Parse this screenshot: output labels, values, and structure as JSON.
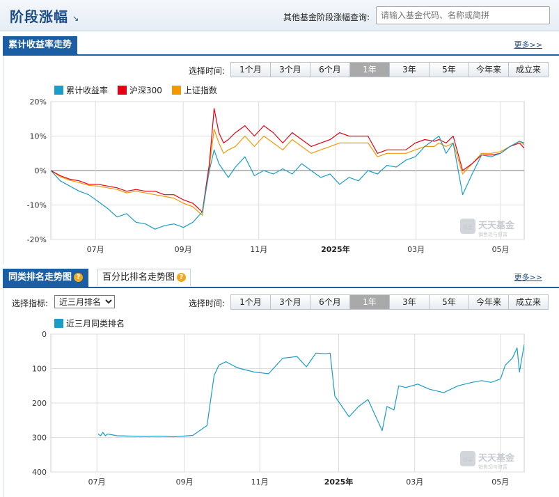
{
  "header": {
    "title": "阶段涨幅",
    "title_arrow": "↘",
    "search_label": "其他基金阶段涨幅查询:",
    "search_placeholder": "请输入基金代码、名称或简拼"
  },
  "section1": {
    "tab": "累计收益率走势",
    "more": "更多>>",
    "time_label": "选择时间:",
    "ranges": [
      "1个月",
      "3个月",
      "6个月",
      "1年",
      "3年",
      "5年",
      "今年来",
      "成立来"
    ],
    "active_range": "1年"
  },
  "section2": {
    "tab_active": "同类排名走势图",
    "tab_inactive": "百分比排名走势图",
    "more": "更多>>",
    "indicator_label": "选择指标:",
    "indicator_value": "近三月排名",
    "time_label": "选择时间:",
    "ranges": [
      "1个月",
      "3个月",
      "6个月",
      "1年",
      "3年",
      "5年",
      "今年来",
      "成立来"
    ],
    "active_range": "1年"
  },
  "watermark": {
    "logo": "天天基金",
    "slogan": "销售您与财富",
    "badge": "基金"
  },
  "colors": {
    "fund": "#1a9dc6",
    "hs300": "#e60012",
    "sh_index": "#f39800",
    "accent": "#1b5ea3"
  },
  "chart_data": [
    {
      "type": "line",
      "title": "",
      "xlabel": "",
      "ylabel": "",
      "ylim": [
        -20,
        20
      ],
      "y_ticks": [
        "20%",
        "10%",
        "0%",
        "-10%",
        "-20%"
      ],
      "x_ticks": [
        "07月",
        "09月",
        "11月",
        "2025年",
        "03月",
        "05月"
      ],
      "x_tick_pos": [
        0.0943,
        0.2796,
        0.4393,
        0.6013,
        0.7715,
        0.9501
      ],
      "grid": true,
      "legend": "top-left",
      "x": [
        0,
        0.02,
        0.04,
        0.06,
        0.08,
        0.1,
        0.12,
        0.14,
        0.16,
        0.18,
        0.2,
        0.22,
        0.24,
        0.26,
        0.28,
        0.3,
        0.32,
        0.335,
        0.345,
        0.355,
        0.365,
        0.375,
        0.39,
        0.41,
        0.43,
        0.45,
        0.47,
        0.49,
        0.51,
        0.53,
        0.55,
        0.57,
        0.59,
        0.61,
        0.63,
        0.65,
        0.67,
        0.69,
        0.71,
        0.73,
        0.75,
        0.77,
        0.79,
        0.81,
        0.82,
        0.835,
        0.85,
        0.87,
        0.89,
        0.91,
        0.93,
        0.95,
        0.97,
        0.99,
        1.0
      ],
      "series": [
        {
          "name": "累计收益率",
          "color": "#1a9dc6",
          "values": [
            0,
            -3,
            -4.5,
            -6,
            -7,
            -9,
            -11,
            -13.5,
            -12.5,
            -15,
            -15.5,
            -17,
            -16,
            -15.5,
            -16.5,
            -15,
            -12,
            0,
            6,
            2,
            0,
            -2,
            1,
            4,
            -1.5,
            0,
            -1,
            0.5,
            -1,
            2,
            0,
            -2,
            -1,
            -4,
            -2,
            -3,
            0,
            -1,
            1.5,
            1,
            3,
            4,
            7,
            9,
            10,
            5,
            8,
            -7,
            -1,
            4.5,
            4,
            5,
            7,
            8.5,
            8
          ]
        },
        {
          "name": "沪深300",
          "color": "#e60012",
          "values": [
            0,
            -1.5,
            -2.5,
            -3,
            -4,
            -4,
            -4.5,
            -5,
            -6,
            -5.5,
            -6,
            -6,
            -7,
            -7,
            -8.5,
            -9.5,
            -12,
            2,
            18,
            11,
            8,
            9,
            11,
            13,
            10,
            13,
            11,
            8,
            11,
            9,
            7,
            8,
            9,
            11,
            10,
            10,
            10,
            5,
            6,
            6,
            6,
            8,
            9,
            8.5,
            9,
            8,
            10,
            0,
            2,
            4.5,
            4.5,
            5,
            7,
            8,
            6.5
          ]
        },
        {
          "name": "上证指数",
          "color": "#f39800",
          "values": [
            0,
            -1.8,
            -2.8,
            -3.5,
            -4.3,
            -4.5,
            -5,
            -5.5,
            -6.5,
            -6,
            -6.5,
            -7,
            -7.5,
            -8,
            -9.5,
            -10.5,
            -13,
            1,
            12,
            8,
            5,
            6,
            7,
            10,
            7,
            10,
            8,
            6,
            9,
            7,
            5,
            6,
            7,
            8,
            8,
            8,
            8,
            4,
            5,
            5,
            5,
            6,
            7,
            7,
            8,
            7,
            8,
            -1,
            2,
            5,
            5,
            5.5,
            7,
            8.5,
            7.5
          ]
        }
      ]
    },
    {
      "type": "line",
      "title": "",
      "xlabel": "",
      "ylabel": "",
      "ylim": [
        400,
        0
      ],
      "y_ticks": [
        "0",
        "100",
        "200",
        "300",
        "400"
      ],
      "x_ticks": [
        "07月",
        "09月",
        "11月",
        "2025年",
        "03月",
        "05月"
      ],
      "x_tick_pos": [
        0.0973,
        0.2825,
        0.4414,
        0.6081,
        0.7687,
        0.9497
      ],
      "grid": true,
      "legend": "top-left",
      "x": [
        0.1,
        0.105,
        0.11,
        0.115,
        0.12,
        0.14,
        0.17,
        0.2,
        0.23,
        0.26,
        0.28,
        0.3,
        0.33,
        0.345,
        0.355,
        0.37,
        0.39,
        0.4,
        0.43,
        0.46,
        0.49,
        0.52,
        0.54,
        0.56,
        0.58,
        0.59,
        0.6,
        0.61,
        0.63,
        0.65,
        0.67,
        0.69,
        0.7,
        0.71,
        0.725,
        0.735,
        0.75,
        0.775,
        0.8,
        0.83,
        0.86,
        0.89,
        0.91,
        0.93,
        0.95,
        0.96,
        0.975,
        0.985,
        0.99,
        1.0
      ],
      "series": [
        {
          "name": "近三月同类排名",
          "color": "#1a9dc6",
          "values": [
            290,
            295,
            285,
            295,
            290,
            295,
            296,
            297,
            296,
            298,
            296,
            294,
            265,
            120,
            90,
            80,
            95,
            100,
            110,
            115,
            70,
            65,
            95,
            55,
            57,
            55,
            180,
            200,
            240,
            210,
            190,
            250,
            280,
            210,
            220,
            150,
            155,
            145,
            160,
            170,
            150,
            140,
            135,
            140,
            130,
            90,
            70,
            40,
            110,
            30
          ]
        }
      ]
    }
  ]
}
